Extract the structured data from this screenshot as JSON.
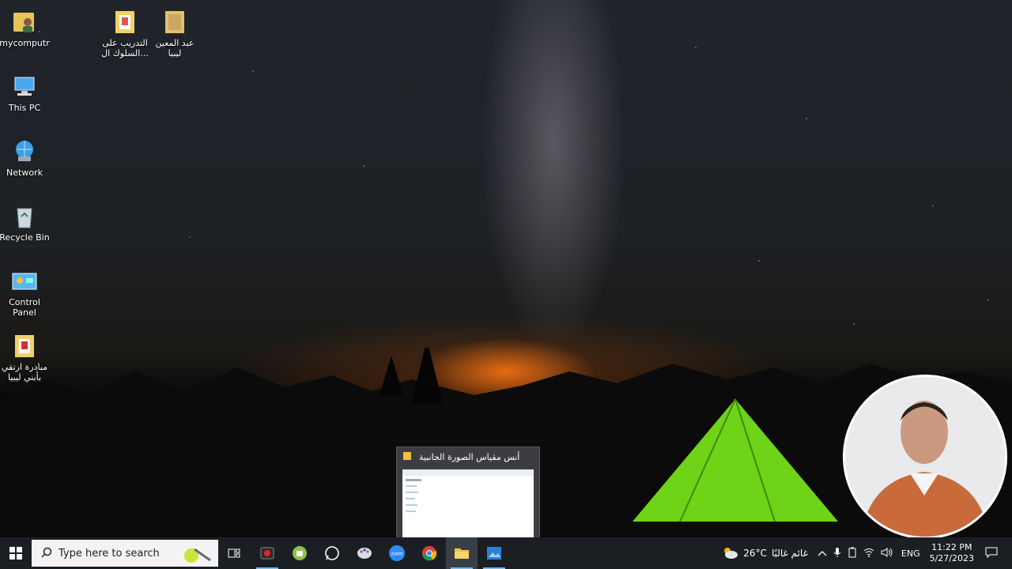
{
  "desktop_icons": [
    {
      "label": "mycomputr",
      "icon": "user-folder-icon"
    },
    {
      "label": "This PC",
      "icon": "this-pc-icon"
    },
    {
      "label": "Network",
      "icon": "network-icon"
    },
    {
      "label": "Recycle Bin",
      "icon": "recycle-bin-icon"
    },
    {
      "label": "Control Panel",
      "icon": "control-panel-icon"
    },
    {
      "label": "مبادرة ارتقي بأبني ليبيا",
      "icon": "document-folder-icon"
    },
    {
      "label": "التدريب على السلوك ال...",
      "icon": "document-folder-icon"
    },
    {
      "label": "عبد المعين ليبيا",
      "icon": "folder-icon"
    }
  ],
  "preview": {
    "title": "أنس مقياس الصورة الجانبية"
  },
  "taskbar": {
    "search_placeholder": "Type here to search",
    "apps": [
      {
        "name": "task-view",
        "icon": "task-view-icon"
      },
      {
        "name": "recorder",
        "icon": "record-icon"
      },
      {
        "name": "android",
        "icon": "android-icon"
      },
      {
        "name": "whatsapp",
        "icon": "whatsapp-icon"
      },
      {
        "name": "paint",
        "icon": "palette-icon"
      },
      {
        "name": "zoom",
        "icon": "zoom-icon",
        "label": "zoom"
      },
      {
        "name": "chrome",
        "icon": "chrome-icon"
      },
      {
        "name": "file-explorer",
        "icon": "folder-icon"
      },
      {
        "name": "photos",
        "icon": "photos-icon"
      }
    ]
  },
  "tray": {
    "weather_temp": "26°C",
    "weather_text": "غائم غالبًا",
    "language": "ENG",
    "time": "11:22 PM",
    "date": "5/27/2023"
  },
  "colors": {
    "taskbar": "#1b1f24",
    "accent": "#76b9ed",
    "tent": "#7ce018"
  }
}
